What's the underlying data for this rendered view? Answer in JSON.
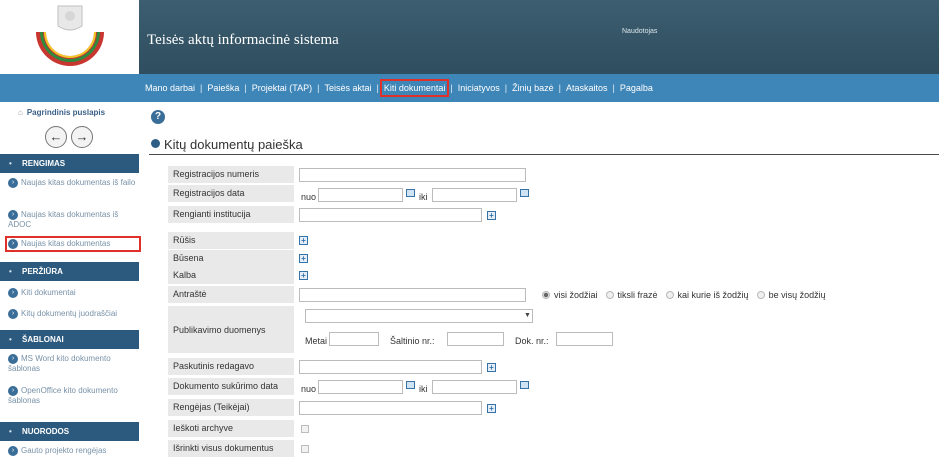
{
  "header": {
    "app_title": "Teisės aktų informacinė sistema",
    "user_label": "Naudotojas"
  },
  "nav": {
    "items": [
      {
        "label": "Mano darbai"
      },
      {
        "label": "Paieška"
      },
      {
        "label": "Projektai (TAP)"
      },
      {
        "label": "Teisės aktai"
      },
      {
        "label": "Kiti dokumentai"
      },
      {
        "label": "Iniciatyvos"
      },
      {
        "label": "Žinių bazė"
      },
      {
        "label": "Ataskaitos"
      },
      {
        "label": "Pagalba"
      }
    ],
    "separator": "|"
  },
  "sidebar": {
    "home": "Pagrindinis puslapis",
    "sections": {
      "rengimas": "RENGIMAS",
      "perziura": "PERŽIŪRA",
      "sablonai": "ŠABLONAI",
      "nuorodos": "NUORODOS"
    },
    "items": {
      "new_from_file": "Naujas kitas dokumentas iš failo",
      "new_from_adoc": "Naujas kitas dokumentas iš ADOC",
      "new_doc": "Naujas kitas dokumentas",
      "other_docs": "Kiti dokumentai",
      "drafts": "Kitų dokumentų juodraščiai",
      "ms_word": "MS Word kito dokumento šablonas",
      "openoffice": "OpenOffice kito dokumento šablonas",
      "received": "Gauto projekto rengėjas"
    }
  },
  "main": {
    "help": "?",
    "title": "Kitų dokumentų paieška",
    "fields": {
      "reg_number": "Registracijos numeris",
      "reg_date": "Registracijos data",
      "institution": "Rengianti institucija",
      "type": "Rūšis",
      "status": "Būsena",
      "language": "Kalba",
      "heading": "Antraštė",
      "publication": "Publikavimo duomenys",
      "last_editor": "Paskutinis redagavo",
      "created_date": "Dokumento sukūrimo data",
      "author": "Rengėjas (Teikėjai)",
      "search_archive": "Ieškoti archyve",
      "select_all": "Išrinkti visus dokumentus"
    },
    "from_label": "nuo",
    "to_label": "iki",
    "radio_options": [
      "visi žodžiai",
      "tiksli frazė",
      "kai kurie iš žodžių",
      "be visų žodžių"
    ],
    "year_label": "Metai",
    "source_label": "Šaltinio nr.:",
    "doc_no_label": "Dok. nr.:"
  }
}
